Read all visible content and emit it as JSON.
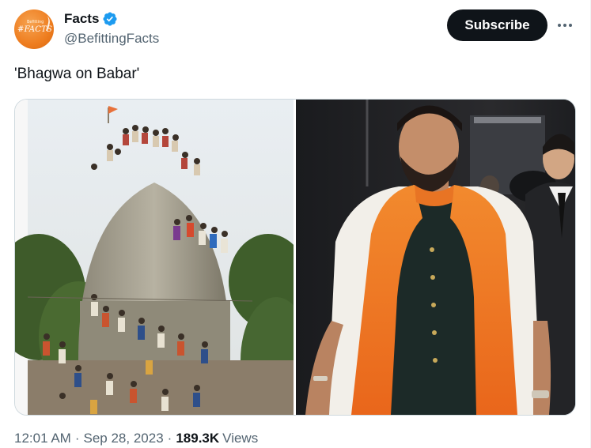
{
  "author": {
    "display_name": "Facts",
    "handle": "@BefittingFacts",
    "verified": true,
    "avatar_text": "#FACTS",
    "avatar_small_text": "Befitting"
  },
  "actions": {
    "subscribe_label": "Subscribe",
    "more_icon": "more-horizontal-icon"
  },
  "tweet": {
    "text": "'Bhagwa on Babar'"
  },
  "media": {
    "image_count": 2
  },
  "meta": {
    "time": "12:01 AM",
    "separator": "·",
    "date": "Sep 28, 2023",
    "views_count": "189.3K",
    "views_label": "Views"
  },
  "colors": {
    "text_primary": "#0f1419",
    "text_secondary": "#536471",
    "verified_blue": "#1d9bf0",
    "avatar_orange": "#ee7d1f",
    "saffron": "#f07a1c",
    "border": "#cfd9de"
  }
}
